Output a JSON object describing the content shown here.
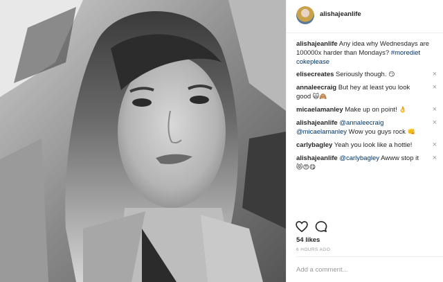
{
  "post": {
    "username": "alishajeanlife",
    "caption": {
      "username": "alishajeanlife",
      "text": " Any idea why Wednesdays are 100000x harder than Mondays? ",
      "hashtag": "#morediet cokeplease"
    },
    "comments": [
      {
        "username": "elisecreates",
        "text": " Seriously though. ",
        "emoji": "😏"
      },
      {
        "username": "annaleecraig",
        "text": " But hey at least you look good ",
        "emoji": "🙀🙈"
      },
      {
        "username": "micaelamanley",
        "text": " Make up on point! ",
        "emoji": "👌"
      },
      {
        "username": "alishajeanlife",
        "mention1": "@annaleecraig",
        "mention2": "@micaelamanley",
        "text": " Wow you guys rock ",
        "emoji": "👊"
      },
      {
        "username": "carlybagley",
        "text": " Yeah you look like a hottie!"
      },
      {
        "username": "alishajeanlife",
        "mention1": "@carlybagley",
        "text": " Awww stop it ",
        "emoji": "😻😍😋"
      }
    ],
    "remove_glyph": "×",
    "likes": "54 likes",
    "timestamp": "6 HOURS AGO",
    "add_comment_placeholder": "Add a comment...",
    "icons": {
      "like": "heart-icon",
      "comment": "comment-bubble-icon"
    }
  }
}
